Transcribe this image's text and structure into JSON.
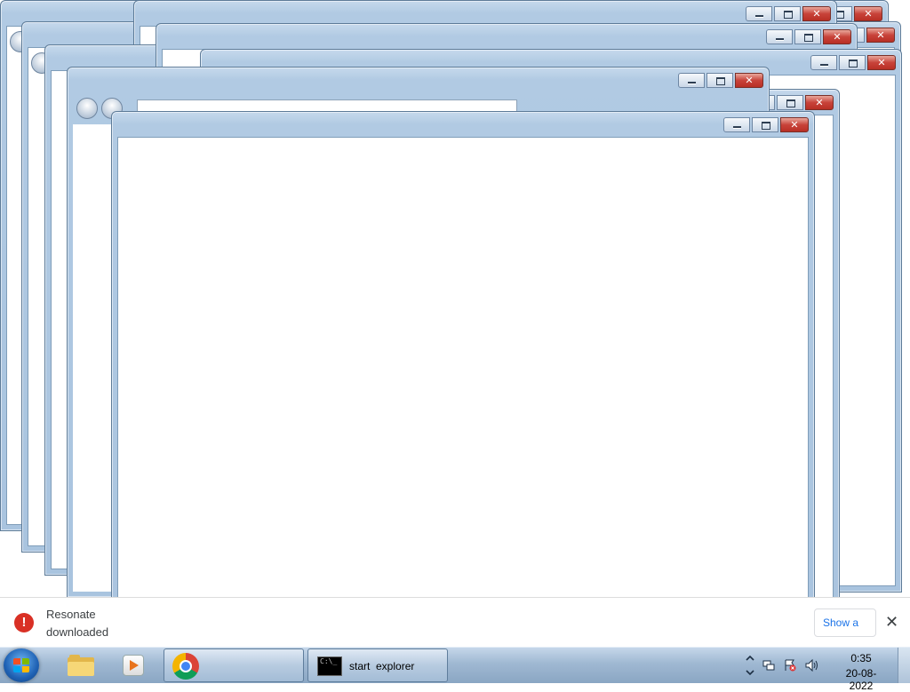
{
  "notification": {
    "line1": "Resonate",
    "line2": "downloaded",
    "show_label": "Show a",
    "close_glyph": "✕",
    "error_glyph": "!"
  },
  "taskbar": {
    "pinned": [
      {
        "name": "windows-explorer",
        "icon": "folder-icon"
      },
      {
        "name": "media-player",
        "icon": "media-player-icon"
      }
    ],
    "tasks": [
      {
        "name": "google-chrome",
        "icon": "chrome-icon",
        "label": ""
      },
      {
        "name": "command-prompt",
        "icon": "cmd-icon",
        "label": "start  explorer"
      }
    ],
    "clock": {
      "time": "0:35",
      "date": "20-08-2022"
    },
    "tray_icons": [
      "show-hidden-icons",
      "network-icon",
      "action-center-flag-icon",
      "volume-icon"
    ]
  },
  "colors": {
    "window_frame": "#b1cae3",
    "close_button": "#c8433a",
    "taskbar": "#9fb8d2",
    "notification_error": "#d93025",
    "link_blue": "#1a73e8"
  }
}
